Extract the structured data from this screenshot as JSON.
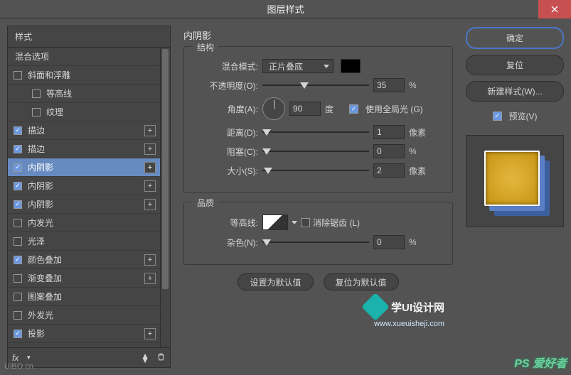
{
  "window": {
    "title": "图层样式"
  },
  "close_icon": "close",
  "left": {
    "header": "样式",
    "items": [
      {
        "label": "混合选项",
        "checkbox": false,
        "checked": false,
        "add": false,
        "indent": false
      },
      {
        "label": "斜面和浮雕",
        "checkbox": true,
        "checked": false,
        "add": false,
        "indent": false
      },
      {
        "label": "等高线",
        "checkbox": true,
        "checked": false,
        "add": false,
        "indent": true
      },
      {
        "label": "纹理",
        "checkbox": true,
        "checked": false,
        "add": false,
        "indent": true
      },
      {
        "label": "描边",
        "checkbox": true,
        "checked": true,
        "add": true,
        "indent": false
      },
      {
        "label": "描边",
        "checkbox": true,
        "checked": true,
        "add": true,
        "indent": false
      },
      {
        "label": "内阴影",
        "checkbox": true,
        "checked": true,
        "add": true,
        "indent": false,
        "selected": true
      },
      {
        "label": "内阴影",
        "checkbox": true,
        "checked": true,
        "add": true,
        "indent": false
      },
      {
        "label": "内阴影",
        "checkbox": true,
        "checked": true,
        "add": true,
        "indent": false
      },
      {
        "label": "内发光",
        "checkbox": true,
        "checked": false,
        "add": false,
        "indent": false
      },
      {
        "label": "光泽",
        "checkbox": true,
        "checked": false,
        "add": false,
        "indent": false
      },
      {
        "label": "颜色叠加",
        "checkbox": true,
        "checked": true,
        "add": true,
        "indent": false
      },
      {
        "label": "渐变叠加",
        "checkbox": true,
        "checked": false,
        "add": true,
        "indent": false
      },
      {
        "label": "图案叠加",
        "checkbox": true,
        "checked": false,
        "add": false,
        "indent": false
      },
      {
        "label": "外发光",
        "checkbox": true,
        "checked": false,
        "add": false,
        "indent": false
      },
      {
        "label": "投影",
        "checkbox": true,
        "checked": true,
        "add": true,
        "indent": false
      }
    ],
    "footer": {
      "fx": "fx"
    }
  },
  "main": {
    "title": "内阴影",
    "structure": {
      "label": "结构",
      "blend_mode_label": "混合模式:",
      "blend_mode_value": "正片叠底",
      "opacity_label": "不透明度(O):",
      "opacity_value": "35",
      "opacity_unit": "%",
      "angle_label": "角度(A):",
      "angle_value": "90",
      "angle_unit": "度",
      "global_light_label": "使用全局光 (G)",
      "distance_label": "距离(D):",
      "distance_value": "1",
      "distance_unit": "像素",
      "choke_label": "阻塞(C):",
      "choke_value": "0",
      "choke_unit": "%",
      "size_label": "大小(S):",
      "size_value": "2",
      "size_unit": "像素"
    },
    "quality": {
      "label": "品质",
      "contour_label": "等高线:",
      "antialias_label": "消除锯齿 (L)",
      "noise_label": "杂色(N):",
      "noise_value": "0",
      "noise_unit": "%"
    },
    "buttons": {
      "default": "设置为默认值",
      "reset": "复位为默认值"
    }
  },
  "right": {
    "ok": "确定",
    "cancel": "复位",
    "new_style": "新建样式(W)...",
    "preview_label": "预览(V)"
  },
  "watermark": {
    "title": "学UI设计网",
    "url": "www.xueuisheji.com",
    "corner": "PS 爱好者",
    "corner2": "UiBO.cn"
  }
}
